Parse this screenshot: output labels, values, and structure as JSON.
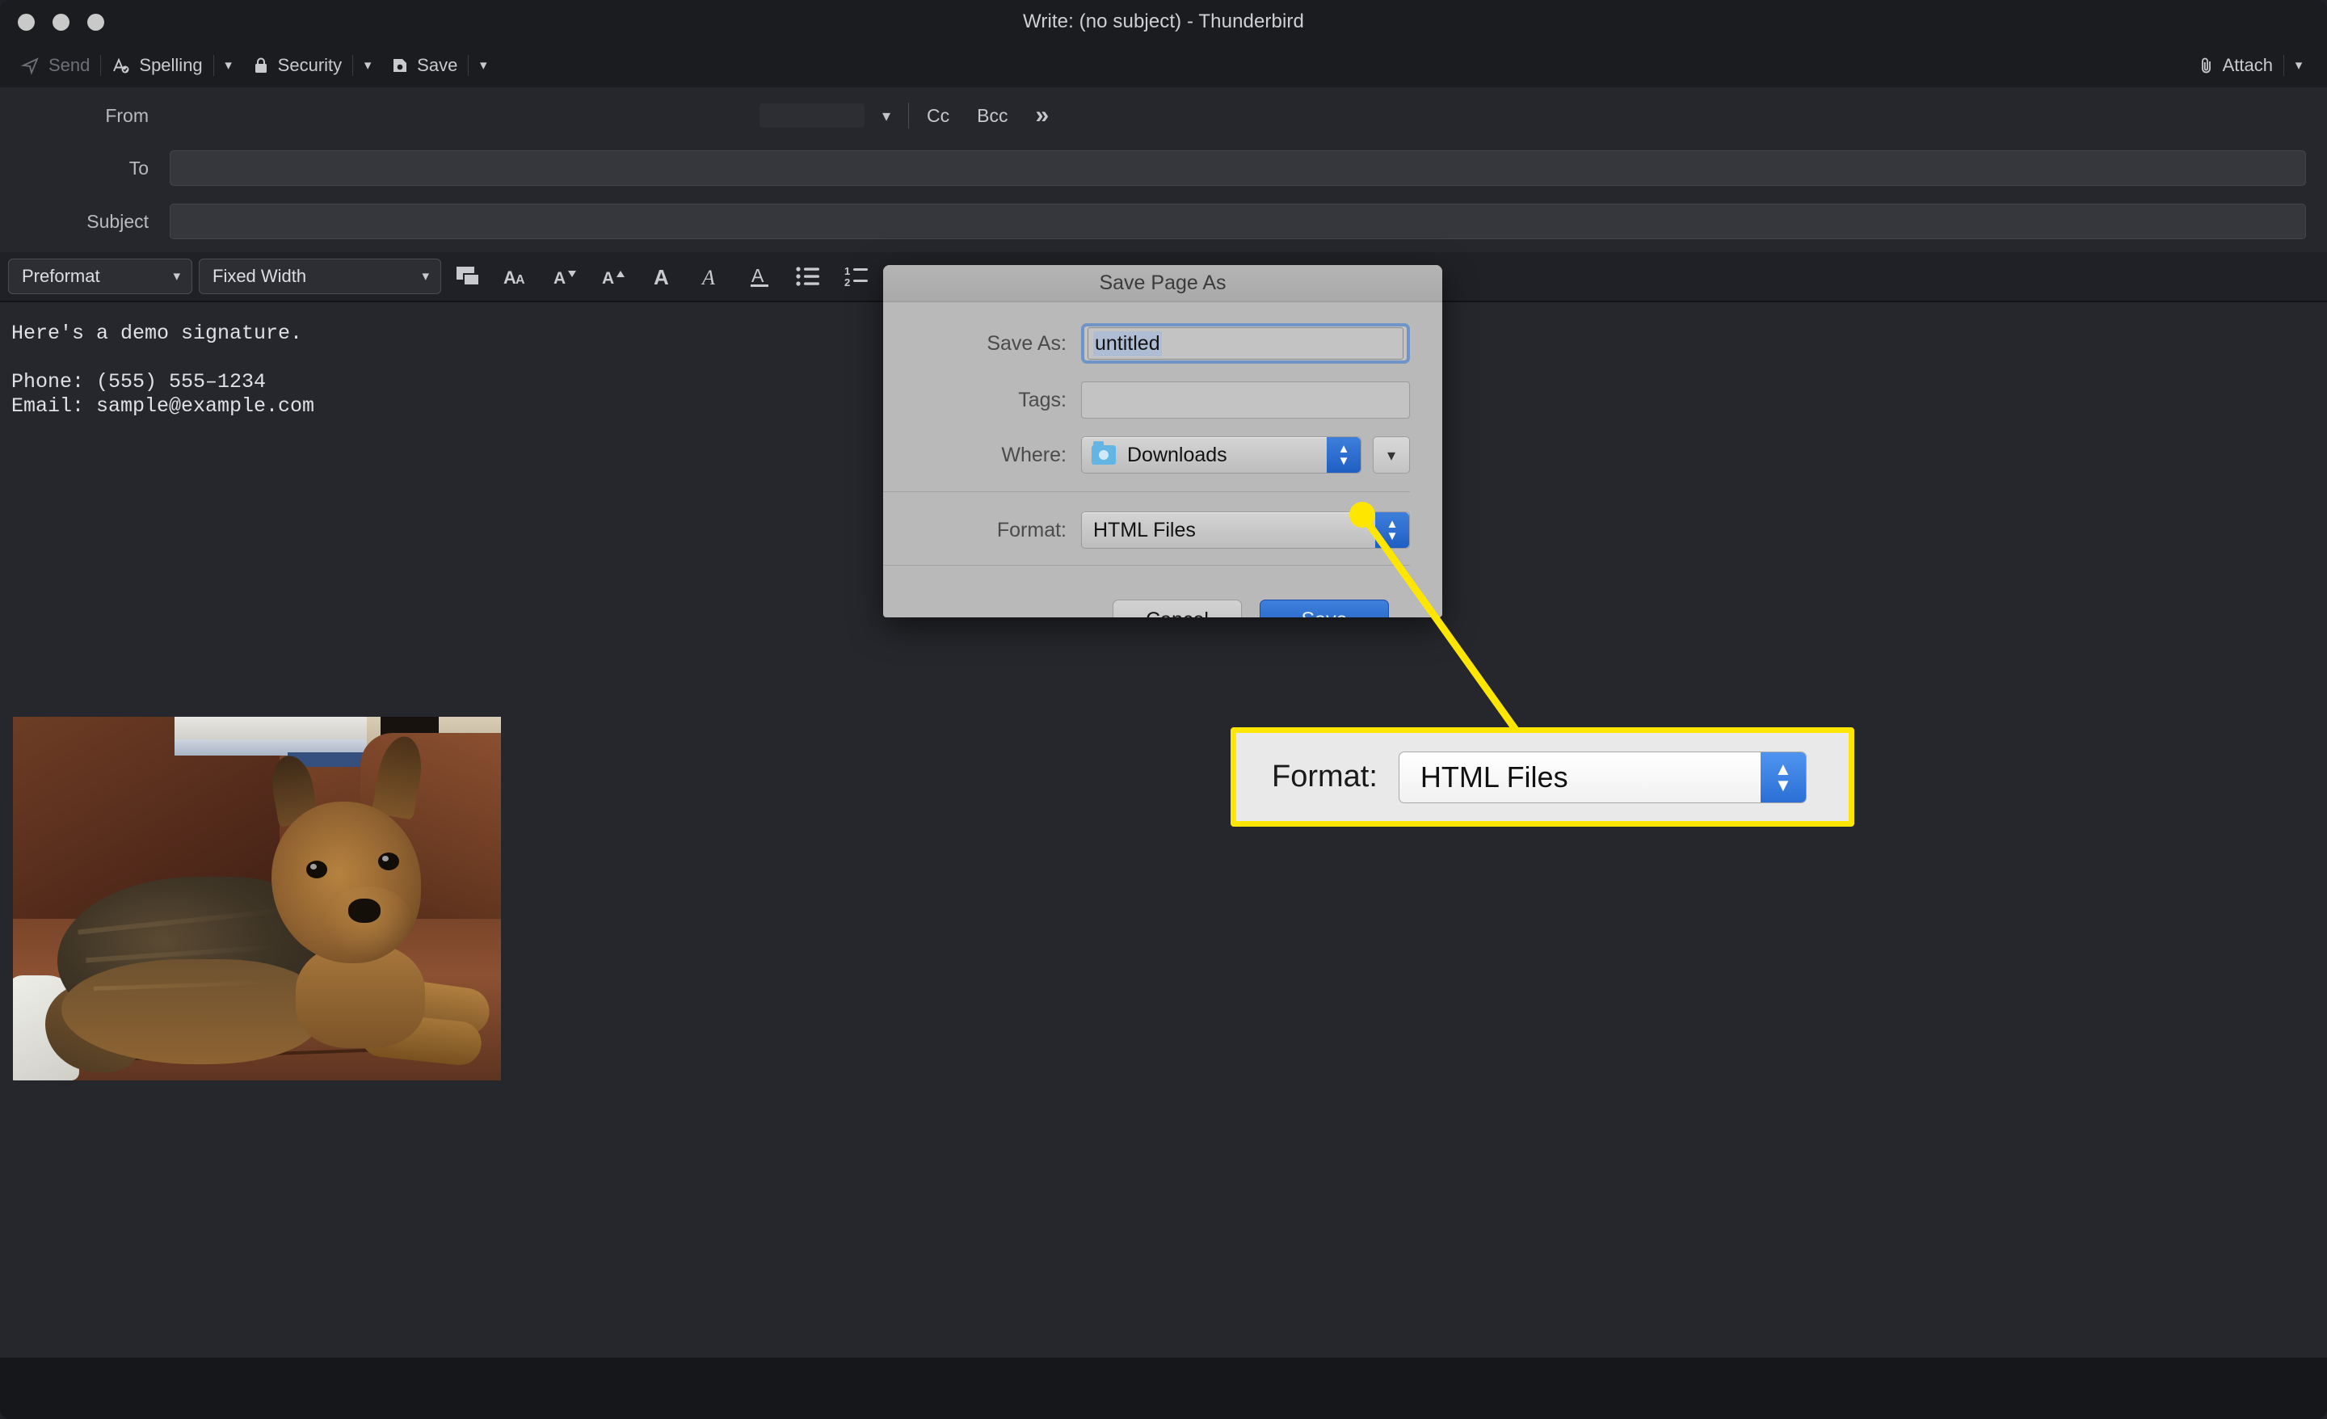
{
  "window": {
    "title": "Write: (no subject) - Thunderbird",
    "traffic_lights": [
      "close",
      "minimize",
      "zoom"
    ]
  },
  "toolbar": {
    "send_label": "Send",
    "spelling_label": "Spelling",
    "security_label": "Security",
    "save_label": "Save",
    "attach_label": "Attach"
  },
  "address": {
    "from_label": "From",
    "to_label": "To",
    "subject_label": "Subject",
    "to_value": "",
    "subject_value": "",
    "cc_label": "Cc",
    "bcc_label": "Bcc",
    "more_label": "»"
  },
  "format_toolbar": {
    "paragraph_style": "Preformat",
    "font_family": "Fixed Width",
    "icons": [
      "text-color-icon",
      "font-size-icon",
      "decrease-size-icon",
      "increase-size-icon",
      "bold-icon",
      "italic-icon",
      "underline-icon",
      "bullet-list-icon",
      "numbered-list-icon"
    ]
  },
  "compose_body": {
    "line1": "Here's a demo signature.",
    "line2": "",
    "line3": "Phone: (555) 555–1234",
    "line4": "Email: sample@example.com",
    "image_alt": "Yorkshire terrier lying on a brown leather couch"
  },
  "dialog": {
    "title": "Save Page As",
    "save_as_label": "Save As:",
    "save_as_value": "untitled",
    "tags_label": "Tags:",
    "tags_value": "",
    "where_label": "Where:",
    "where_value": "Downloads",
    "format_label": "Format:",
    "format_value": "HTML Files",
    "cancel_label": "Cancel",
    "save_label": "Save"
  },
  "callout": {
    "label": "Format:",
    "value": "HTML Files",
    "highlight_color": "#ffe600"
  },
  "colors": {
    "app_background": "#202126",
    "titlebar": "#1b1c20",
    "address_panel": "#26272c",
    "field": "#35373d",
    "dialog_background": "#b9b9b9",
    "accent_blue": "#2b6fd6",
    "callout_yellow": "#ffe600"
  }
}
